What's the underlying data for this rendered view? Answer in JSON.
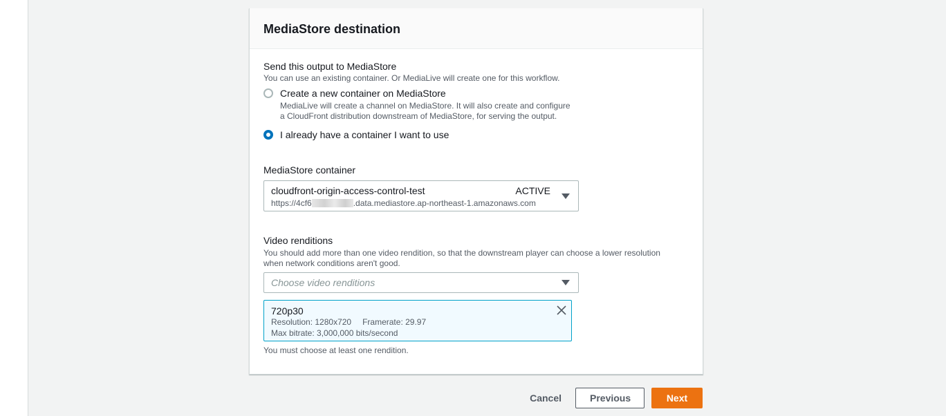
{
  "panel": {
    "title": "MediaStore destination"
  },
  "send_output": {
    "label": "Send this output to MediaStore",
    "description": "You can use an existing container. Or MediaLive will create one for this workflow.",
    "options": [
      {
        "label": "Create a new container on MediaStore",
        "description_line1": "MediaLive will create a channel on MediaStore. It will also create and configure",
        "description_line2": "a CloudFront distribution downstream of MediaStore, for serving the output.",
        "selected": false
      },
      {
        "label": "I already have a container I want to use",
        "selected": true
      }
    ]
  },
  "container": {
    "label": "MediaStore container",
    "name": "cloudfront-origin-access-control-test",
    "status": "ACTIVE",
    "url_prefix": "https://4cf6",
    "url_suffix": ".data.mediastore.ap-northeast-1.amazonaws.com"
  },
  "renditions": {
    "label": "Video renditions",
    "description_line1": "You should add more than one video rendition, so that the downstream player can choose a lower resolution",
    "description_line2": "when network conditions aren't good.",
    "placeholder": "Choose video renditions",
    "selected": {
      "title": "720p30",
      "resolution": "Resolution: 1280x720",
      "framerate": "Framerate: 29.97",
      "bitrate": "Max bitrate: 3,000,000 bits/second"
    },
    "constraint": "You must choose at least one rendition."
  },
  "actions": {
    "cancel": "Cancel",
    "previous": "Previous",
    "next": "Next"
  },
  "colors": {
    "primary": "#ec7211",
    "radio_selected": "#0073bb",
    "token_border": "#00a1c9"
  }
}
